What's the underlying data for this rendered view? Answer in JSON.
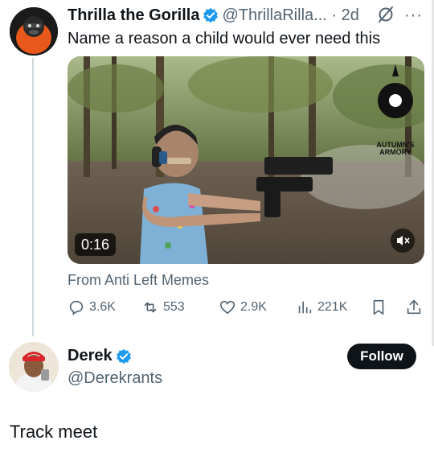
{
  "tweet": {
    "author_name": "Thrilla the Gorilla",
    "handle_time": "@ThrillaRilla... · 2d",
    "text": "Name a reason a child would ever need this",
    "video": {
      "duration": "0:16",
      "watermark": "AUTUMN'S ARMORY"
    },
    "source": "From Anti Left Memes",
    "stats": {
      "replies": "3.6K",
      "reposts": "553",
      "likes": "2.9K",
      "views": "221K"
    }
  },
  "reply": {
    "author_name": "Derek",
    "handle": "@Derekrants",
    "follow_label": "Follow",
    "text": "Track meet"
  },
  "colors": {
    "text": "#0f1419",
    "muted": "#536471",
    "verified": "#1d9bf0",
    "follow_bg": "#0f1419"
  },
  "icons": [
    "verified-badge-icon",
    "grok-icon",
    "more-icon",
    "reply-icon",
    "repost-icon",
    "like-icon",
    "views-icon",
    "bookmark-icon",
    "share-icon",
    "mute-icon"
  ]
}
